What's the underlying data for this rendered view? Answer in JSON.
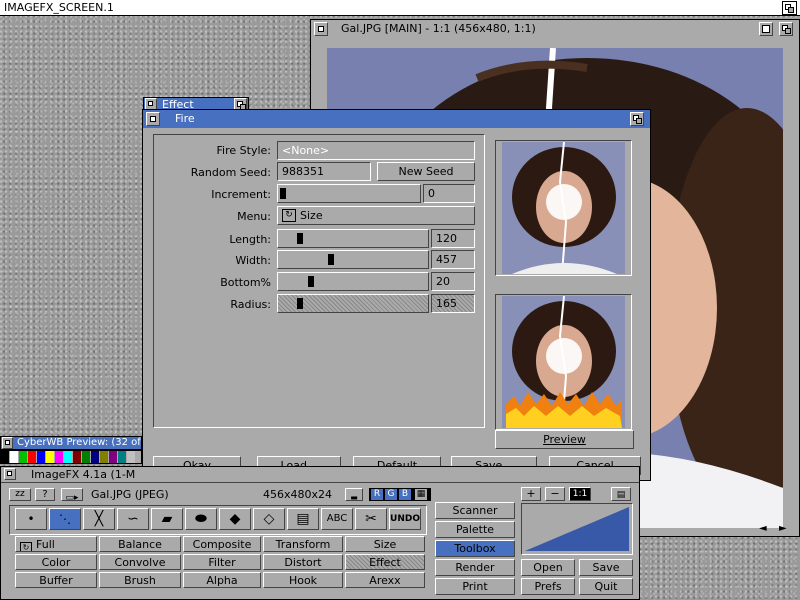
{
  "screen": {
    "title": "IMAGEFX_SCREEN.1"
  },
  "main_window": {
    "title": "Gal.JPG [MAIN] - 1:1 (456x480, 1:1)"
  },
  "effect_window": {
    "title": "Effect"
  },
  "fire": {
    "title": "Fire",
    "fire_style_label": "Fire Style:",
    "fire_style_value": "<None>",
    "random_seed_label": "Random Seed:",
    "random_seed_value": "988351",
    "new_seed_label": "New Seed",
    "increment_label": "Increment:",
    "increment_value": "0",
    "increment_level": 0,
    "menu_label": "Menu:",
    "menu_value": "Size",
    "length_label": "Length:",
    "length_value": "120",
    "length_level": 0.12,
    "width_label": "Width:",
    "width_value": "457",
    "width_level": 0.34,
    "bottom_label": "Bottom%",
    "bottom_value": "20",
    "bottom_level": 0.2,
    "radius_label": "Radius:",
    "radius_value": "165",
    "radius_level": 0.12,
    "preview_label": "Preview",
    "buttons": {
      "okay": "Okay",
      "load": "Load...",
      "default": "Default",
      "save": "Save...",
      "cancel": "Cancel"
    }
  },
  "cyberwb": {
    "title": "CyberWB Preview: (32 of"
  },
  "palette_colors": [
    "#000000",
    "#ffffff",
    "#00c000",
    "#ff0000",
    "#0000ff",
    "#ffff00",
    "#ff00ff",
    "#00ffff",
    "#800000",
    "#008000",
    "#000080",
    "#808000",
    "#800080",
    "#008080",
    "#c0c0c0",
    "#808080"
  ],
  "toolbox": {
    "title": "ImageFX 4.1a (1-M",
    "small_buttons": [
      "zz",
      "?"
    ],
    "filename": "Gal.JPG (JPEG)",
    "dimensions": "456x480x24",
    "rgb": [
      "R",
      "G",
      "B"
    ],
    "undo": "UNDO",
    "options": [
      [
        "Full",
        "Balance",
        "Composite",
        "Transform",
        "Size"
      ],
      [
        "Color",
        "Convolve",
        "Filter",
        "Distort",
        "Effect"
      ],
      [
        "Buffer",
        "Brush",
        "Alpha",
        "Hook",
        "Arexx"
      ]
    ],
    "right_buttons": [
      "Scanner",
      "Palette",
      "Toolbox",
      "Render",
      "Print"
    ],
    "bottom_buttons": [
      "Open",
      "Save",
      "Prefs",
      "Quit"
    ],
    "zoom": [
      "+",
      "−",
      "1:1"
    ]
  },
  "colors": {
    "title_blue": "#4870c0",
    "ui_grey": "#aaaaaa",
    "image_bg": "#7880b0",
    "histogram_blue": "#3858a8"
  }
}
